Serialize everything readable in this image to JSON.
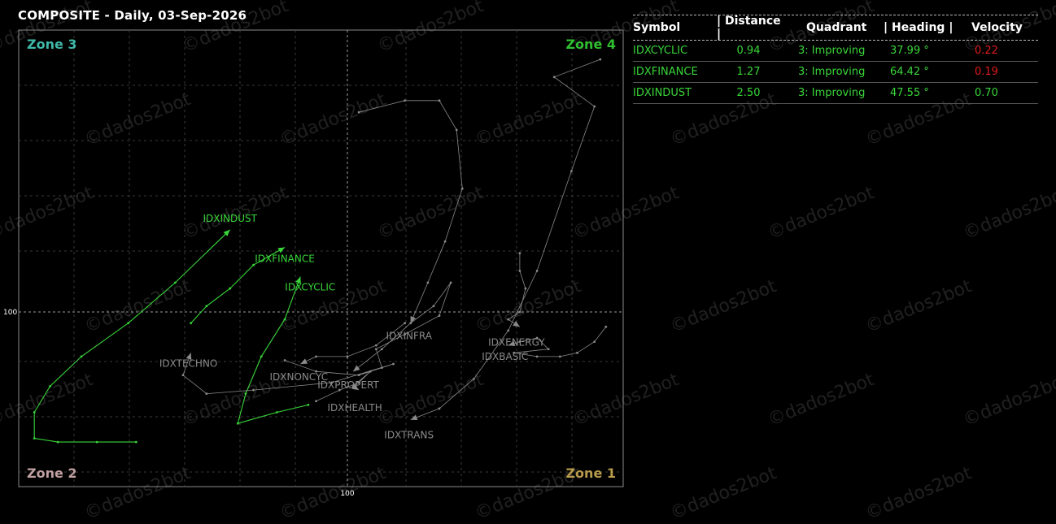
{
  "title": "COMPOSITE - Daily, 03-Sep-2026",
  "watermark": "©dados2bot",
  "colors": {
    "green": "#39d639",
    "gray": "#8a8a8a",
    "red": "#e01c1c",
    "zone3": "#3fb8a8",
    "zone4": "#2fbf2f",
    "zone2": "#c0a0a0",
    "zone1": "#b89a4a"
  },
  "chart_data": {
    "type": "scatter",
    "title": "COMPOSITE - Daily, 03-Sep-2026",
    "xlabel": "",
    "ylabel": "",
    "x_center": 100,
    "y_center": 100,
    "x_tick_label": "100",
    "y_tick_label": "100",
    "xlim": [
      95.8,
      104.8
    ],
    "ylim": [
      95.3,
      104.8
    ],
    "grid": true,
    "zones": [
      {
        "name": "Zone 3",
        "corner": "top-left"
      },
      {
        "name": "Zone 4",
        "corner": "top-right"
      },
      {
        "name": "Zone 2",
        "corner": "bottom-left"
      },
      {
        "name": "Zone 1",
        "corner": "bottom-right"
      }
    ],
    "series": [
      {
        "name": "IDXINDUST",
        "highlight": true,
        "points": [
          [
            97.3,
            96.5
          ],
          [
            96.8,
            96.5
          ],
          [
            96.3,
            96.5
          ],
          [
            96.0,
            96.6
          ],
          [
            96.0,
            97.3
          ],
          [
            96.2,
            98.0
          ],
          [
            96.6,
            98.8
          ],
          [
            97.2,
            99.7
          ],
          [
            97.8,
            100.5
          ],
          [
            98.5,
            101.4
          ]
        ]
      },
      {
        "name": "IDXFINANCE",
        "highlight": true,
        "points": [
          [
            98.0,
            99.7
          ],
          [
            98.2,
            100.1
          ],
          [
            98.5,
            100.4
          ],
          [
            98.8,
            100.8
          ],
          [
            99.2,
            101.1
          ]
        ]
      },
      {
        "name": "IDXCYCLIC",
        "highlight": true,
        "points": [
          [
            99.5,
            97.5
          ],
          [
            99.1,
            97.3
          ],
          [
            98.6,
            97.0
          ],
          [
            98.7,
            97.8
          ],
          [
            98.9,
            98.8
          ],
          [
            99.2,
            99.8
          ],
          [
            99.4,
            100.6
          ]
        ]
      },
      {
        "name": "IDXTECHNO",
        "highlight": false,
        "points": [
          [
            99.2,
            98.7
          ],
          [
            99.6,
            98.4
          ],
          [
            100.2,
            98.3
          ],
          [
            100.8,
            98.6
          ],
          [
            99.8,
            98.1
          ],
          [
            98.8,
            97.9
          ],
          [
            98.2,
            97.8
          ],
          [
            97.9,
            98.3
          ],
          [
            98.0,
            98.9
          ]
        ]
      },
      {
        "name": "IDXNONCYC",
        "highlight": false,
        "points": [
          [
            101.0,
            99.7
          ],
          [
            100.5,
            99.1
          ],
          [
            100.0,
            98.8
          ],
          [
            99.6,
            98.8
          ],
          [
            99.4,
            98.6
          ]
        ]
      },
      {
        "name": "IDXPROPERT",
        "highlight": false,
        "points": [
          [
            100.6,
            98.5
          ],
          [
            100.5,
            99.0
          ],
          [
            101.0,
            99.4
          ],
          [
            101.6,
            99.9
          ],
          [
            101.8,
            100.5
          ],
          [
            101.5,
            100.1
          ],
          [
            101.1,
            99.7
          ],
          [
            100.6,
            99.0
          ],
          [
            100.1,
            98.4
          ]
        ]
      },
      {
        "name": "IDXHEALTH",
        "highlight": false,
        "points": [
          [
            99.6,
            97.6
          ],
          [
            99.9,
            97.9
          ],
          [
            100.2,
            98.1
          ],
          [
            100.4,
            98.4
          ],
          [
            100.1,
            98.0
          ],
          [
            100.2,
            97.9
          ]
        ]
      },
      {
        "name": "IDXINFRA",
        "highlight": false,
        "points": [
          [
            100.2,
            103.4
          ],
          [
            101.0,
            103.6
          ],
          [
            101.6,
            103.6
          ],
          [
            101.9,
            103.1
          ],
          [
            102.0,
            102.1
          ],
          [
            101.7,
            101.2
          ],
          [
            101.4,
            100.5
          ],
          [
            101.1,
            99.7
          ]
        ]
      },
      {
        "name": "IDXTRANS",
        "highlight": false,
        "points": [
          [
            104.4,
            104.3
          ],
          [
            103.6,
            104.0
          ],
          [
            104.3,
            103.5
          ],
          [
            103.9,
            102.4
          ],
          [
            103.3,
            100.7
          ],
          [
            102.8,
            99.5
          ],
          [
            102.2,
            98.2
          ],
          [
            101.6,
            97.4
          ],
          [
            101.1,
            97.1
          ]
        ]
      },
      {
        "name": "IDXENERGY",
        "highlight": false,
        "points": [
          [
            103.0,
            101.0
          ],
          [
            103.0,
            100.7
          ],
          [
            103.1,
            100.4
          ],
          [
            103.0,
            100.0
          ],
          [
            102.8,
            99.8
          ],
          [
            103.0,
            99.6
          ]
        ]
      },
      {
        "name": "IDXBASIC",
        "highlight": false,
        "points": [
          [
            104.5,
            99.6
          ],
          [
            104.3,
            99.2
          ],
          [
            104.0,
            98.9
          ],
          [
            103.7,
            98.8
          ],
          [
            103.3,
            98.8
          ],
          [
            102.9,
            98.9
          ],
          [
            103.5,
            99.0
          ],
          [
            103.3,
            99.3
          ],
          [
            103.0,
            99.2
          ],
          [
            102.8,
            99.1
          ]
        ]
      }
    ]
  },
  "table": {
    "headers": [
      "Symbol",
      "| Distance |",
      "Quadrant",
      "| Heading |",
      "Velocity"
    ],
    "rows": [
      {
        "symbol": "IDXCYCLIC",
        "distance": "0.94",
        "quadrant": "3: Improving",
        "heading": "37.99 °",
        "velocity": "0.22",
        "velocity_color": "#e01c1c"
      },
      {
        "symbol": "IDXFINANCE",
        "distance": "1.27",
        "quadrant": "3: Improving",
        "heading": "64.42 °",
        "velocity": "0.19",
        "velocity_color": "#e01c1c"
      },
      {
        "symbol": "IDXINDUST",
        "distance": "2.50",
        "quadrant": "3: Improving",
        "heading": "47.55 °",
        "velocity": "0.70",
        "velocity_color": "#39d639"
      }
    ]
  }
}
